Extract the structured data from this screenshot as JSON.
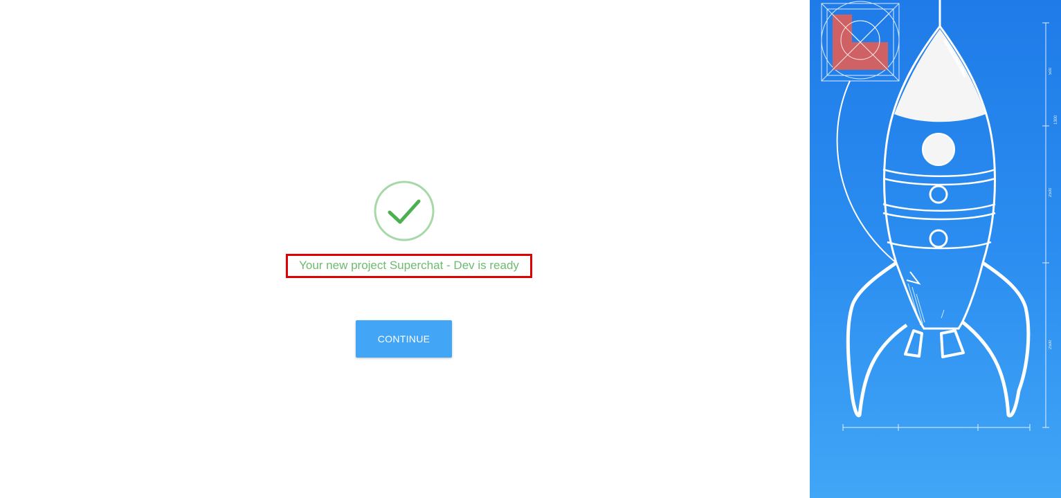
{
  "status": {
    "message": "Your new project Superchat - Dev is ready"
  },
  "actions": {
    "continue_label": "CONTINUE"
  },
  "icons": {
    "success": "check-circle-icon",
    "illustration": "rocket-blueprint"
  },
  "illustration": {
    "dimension_labels": [
      "500",
      "1300",
      "2500",
      "2500"
    ]
  },
  "colors": {
    "success": "#4caf50",
    "button": "#42a5f5",
    "panel_top": "#1f7be8",
    "panel_bottom": "#41a6f6",
    "highlight_border": "#e00000"
  }
}
